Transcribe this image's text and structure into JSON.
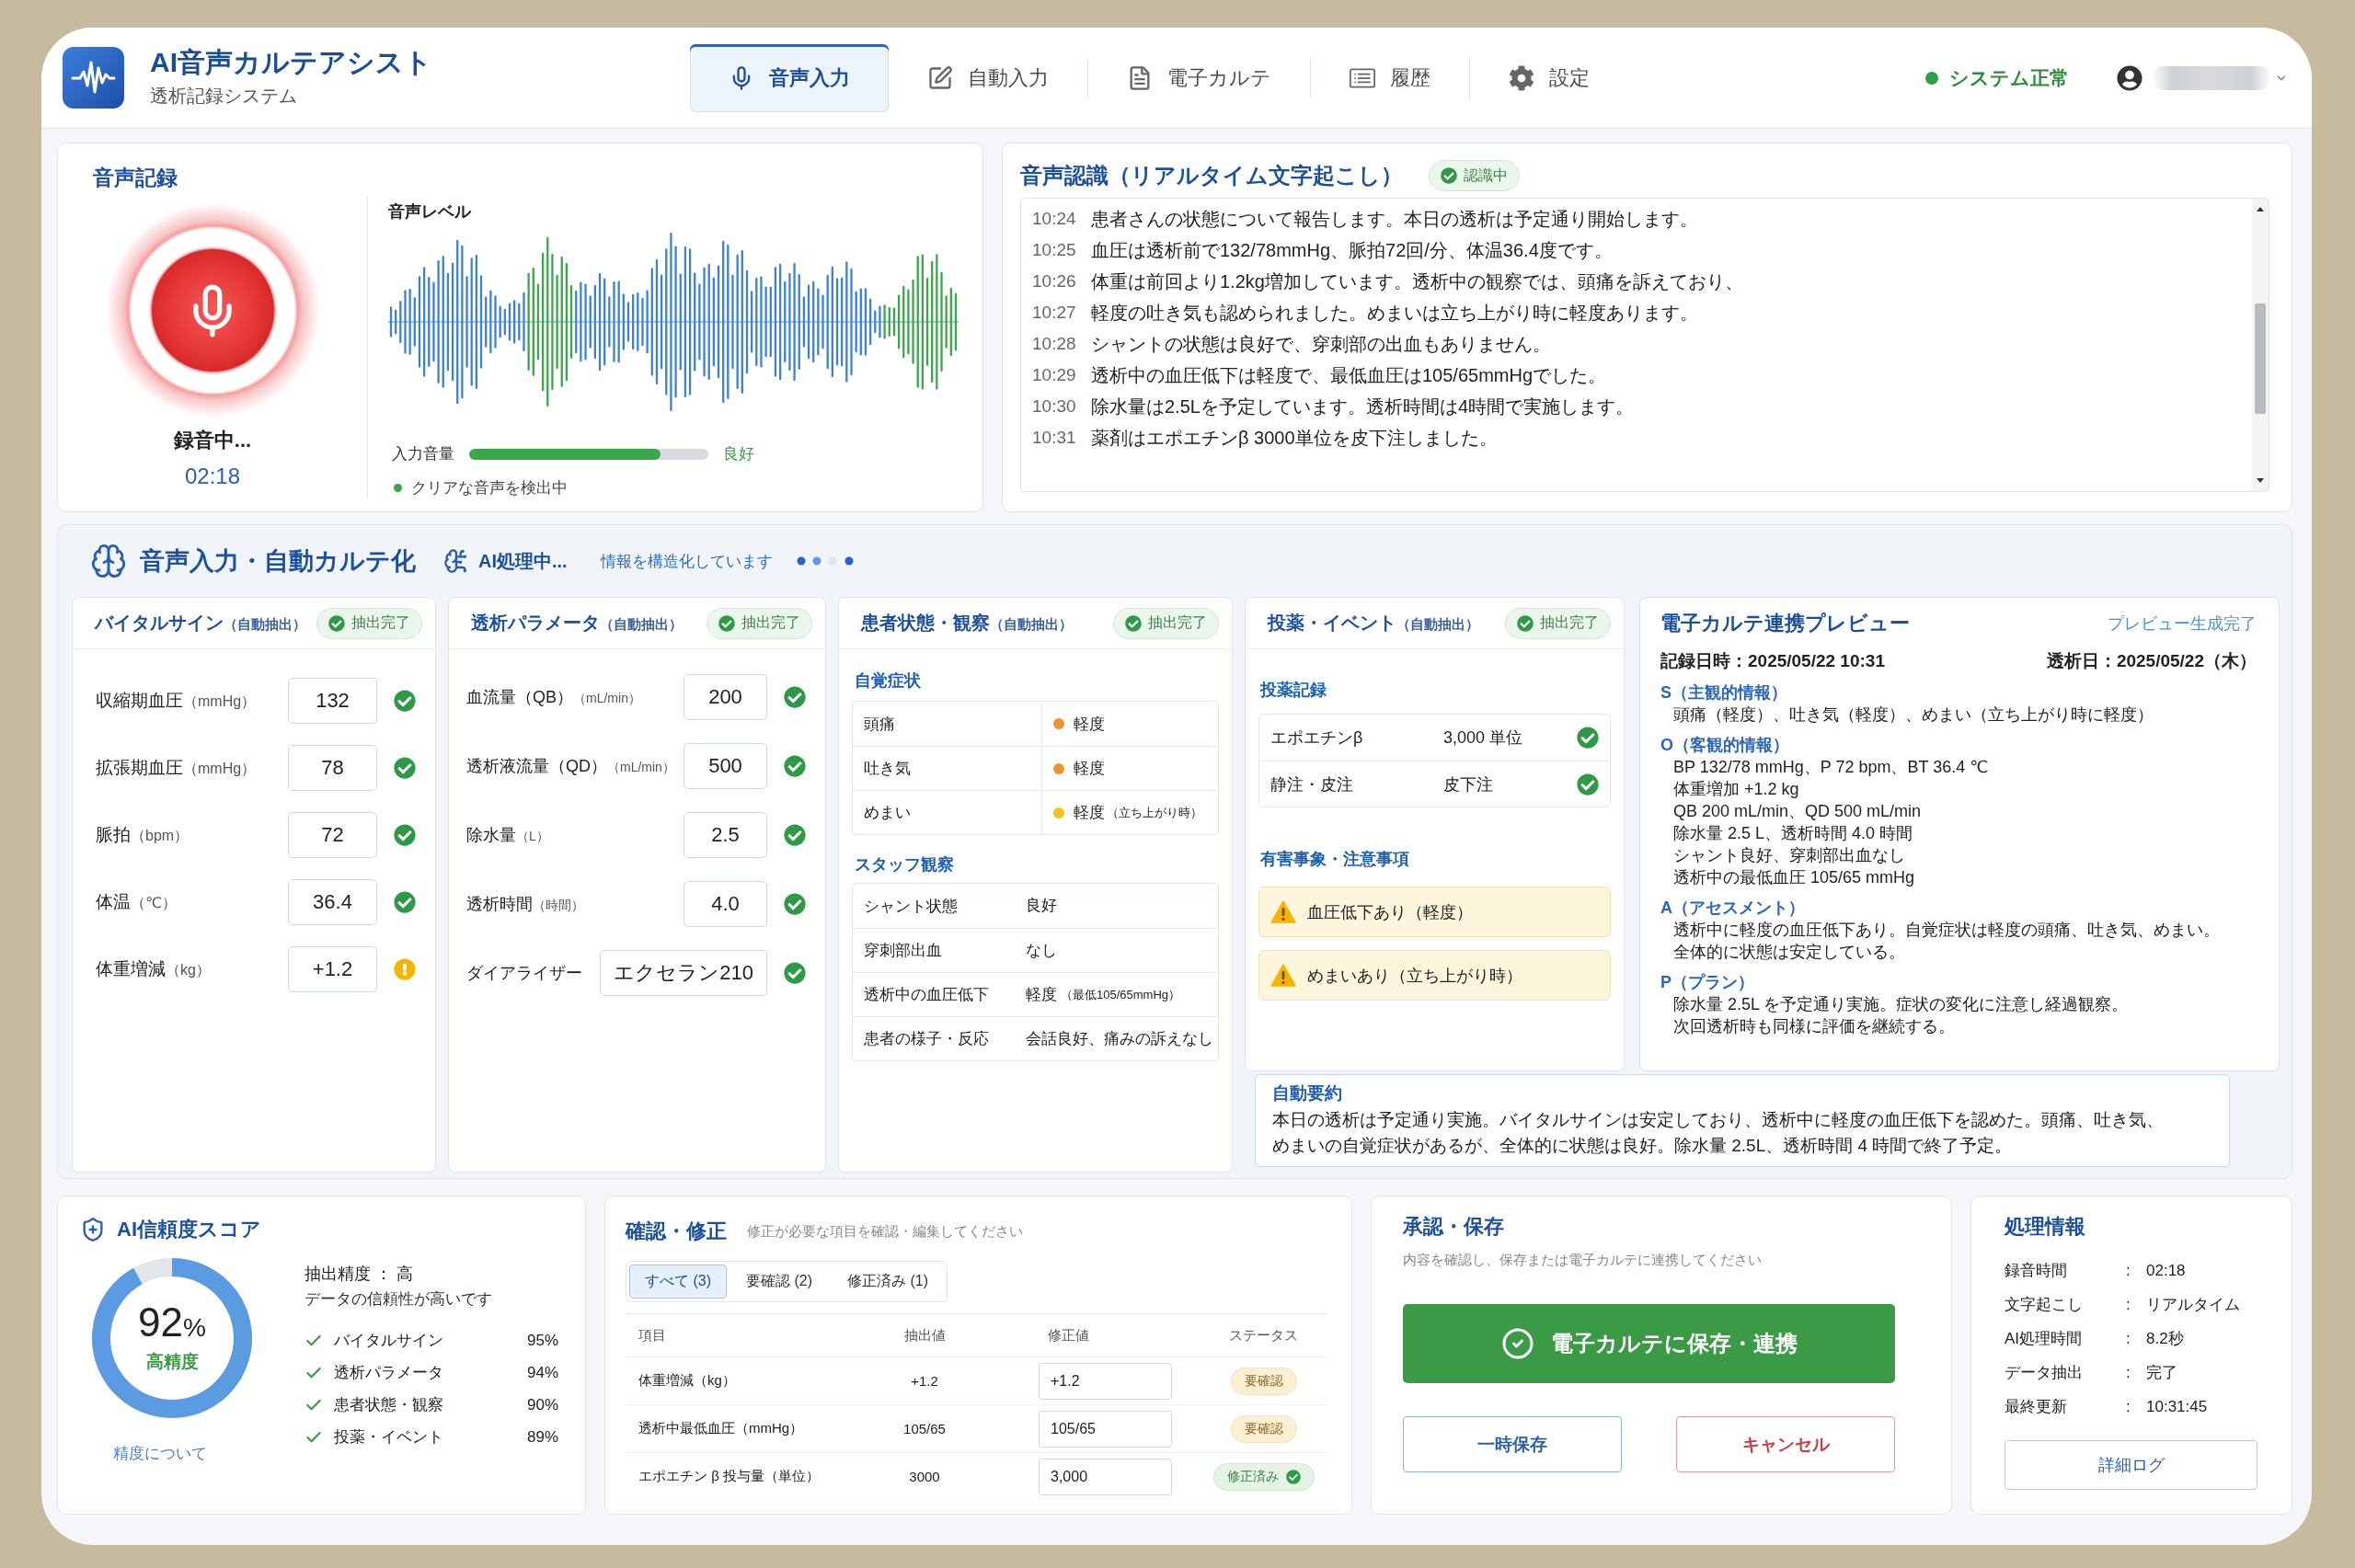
{
  "header": {
    "title": "AI音声カルテアシスト",
    "subtitle": "透析記録システム",
    "nav": [
      {
        "label": "音声入力",
        "kind": "mic",
        "selected": true
      },
      {
        "label": "自動入力",
        "kind": "edit",
        "selected": false
      },
      {
        "label": "電子カルテ",
        "kind": "document",
        "selected": false
      },
      {
        "label": "履歴",
        "kind": "list",
        "selected": false
      },
      {
        "label": "設定",
        "kind": "gear",
        "selected": false
      }
    ],
    "system_status": "システム正常"
  },
  "recording": {
    "title": "音声記録",
    "status": "録音中...",
    "time": "02:18",
    "level_title": "音声レベル",
    "input": {
      "label": "入力音量",
      "level": 0.8,
      "reading": "良好"
    },
    "detection": "クリアな音声を検出中"
  },
  "transcript": {
    "title": "音声認識（リアルタイム文字起こし）",
    "badge": "認識中",
    "lines": [
      {
        "time": "10:24",
        "text": "患者さんの状態について報告します。本日の透析は予定通り開始します。"
      },
      {
        "time": "10:25",
        "text": "血圧は透析前で132/78mmHg、脈拍72回/分、体温36.4度です。"
      },
      {
        "time": "10:26",
        "text": "体重は前回より1.2kg増加しています。透析中の観察では、頭痛を訴えており、"
      },
      {
        "time": "10:27",
        "text": "軽度の吐き気も認められました。めまいは立ち上がり時に軽度あります。"
      },
      {
        "time": "10:28",
        "text": "シャントの状態は良好で、穿刺部の出血もありません。"
      },
      {
        "time": "10:29",
        "text": "透析中の血圧低下は軽度で、最低血圧は105/65mmHgでした。"
      },
      {
        "time": "10:30",
        "text": "除水量は2.5Lを予定しています。透析時間は4時間で実施します。"
      },
      {
        "time": "10:31",
        "text": "薬剤はエポエチンβ 3000単位を皮下注しました。"
      }
    ]
  },
  "auto_chart": {
    "title": "音声入力・自動カルテ化",
    "ai_status": "AI処理中...",
    "ai_detail": "情報を構造化しています",
    "vitals": {
      "title": "バイタルサイン",
      "title_note": "（自動抽出）",
      "badge": "抽出完了",
      "rows": [
        {
          "label": "収縮期血圧",
          "unit": "（mmHg）",
          "value": "132",
          "flagged": false
        },
        {
          "label": "拡張期血圧",
          "unit": "（mmHg）",
          "value": "78",
          "flagged": false
        },
        {
          "label": "脈拍",
          "unit": "（bpm）",
          "value": "72",
          "flagged": false
        },
        {
          "label": "体温",
          "unit": "（℃）",
          "value": "36.4",
          "flagged": false
        },
        {
          "label": "体重増減",
          "unit": "（kg）",
          "value": "+1.2",
          "flagged": true
        }
      ]
    },
    "params": {
      "title": "透析パラメータ",
      "title_note": "（自動抽出）",
      "badge": "抽出完了",
      "rows": [
        {
          "label": "血流量（QB）",
          "unit": "（mL/min）",
          "value": "200",
          "flagged": false
        },
        {
          "label": "透析液流量（QD）",
          "unit": "（mL/min）",
          "value": "500",
          "flagged": false
        },
        {
          "label": "除水量",
          "unit": "（L）",
          "value": "2.5",
          "flagged": false
        },
        {
          "label": "透析時間",
          "unit": "（時間）",
          "value": "4.0",
          "flagged": false
        },
        {
          "label": "ダイアライザー",
          "value": "エクセラン210",
          "flagged": false
        }
      ]
    },
    "patient": {
      "title": "患者状態・観察",
      "title_note": "（自動抽出）",
      "badge": "抽出完了",
      "symptoms": {
        "title": "自覚症状",
        "rows": [
          {
            "label": "頭痛",
            "value": "軽度",
            "color": "#f0922e"
          },
          {
            "label": "吐き気",
            "value": "軽度",
            "color": "#f0922e"
          },
          {
            "label": "めまい",
            "value": "軽度",
            "note": "（立ち上がり時）",
            "color": "#f5c21b"
          }
        ]
      },
      "staff": {
        "title": "スタッフ観察",
        "rows": [
          {
            "label": "シャント状態",
            "value": "良好"
          },
          {
            "label": "穿刺部出血",
            "value": "なし"
          },
          {
            "label": "透析中の血圧低下",
            "value": "軽度",
            "note": "（最低105/65mmHg）"
          },
          {
            "label": "患者の様子・反応",
            "value": "会話良好、痛みの訴えなし"
          }
        ]
      }
    },
    "meds": {
      "title": "投薬・イベント",
      "title_note": "（自動抽出）",
      "badge": "抽出完了",
      "records_title": "投薬記録",
      "records": [
        {
          "label": "エポエチンβ",
          "value": "3,000 単位",
          "confirmed": true
        },
        {
          "label": "静注・皮注",
          "value": "皮下注",
          "confirmed": true
        }
      ],
      "alerts_title": "有害事象・注意事項",
      "alerts": [
        "血圧低下あり（軽度）",
        "めまいあり（立ち上がり時）"
      ]
    },
    "preview": {
      "title": "電子カルテ連携プレビュー",
      "status": "プレビュー生成完了",
      "record_date": "記録日時：2025/05/22 10:31",
      "dialysis_date": "透析日：2025/05/22（木）",
      "sections": [
        {
          "heading": "S（主観的情報）",
          "lines": [
            "頭痛（軽度）、吐き気（軽度）、めまい（立ち上がり時に軽度）"
          ]
        },
        {
          "heading": "O（客観的情報）",
          "lines": [
            "BP 132/78 mmHg、P 72 bpm、BT 36.4 ℃",
            "体重増加 +1.2 kg",
            "QB 200 mL/min、QD 500 mL/min",
            "除水量 2.5 L、透析時間 4.0 時間",
            "シャント良好、穿刺部出血なし",
            "透析中の最低血圧 105/65 mmHg"
          ]
        },
        {
          "heading": "A（アセスメント）",
          "lines": [
            "透析中に軽度の血圧低下あり。自覚症状は軽度の頭痛、吐き気、めまい。",
            "全体的に状態は安定している。"
          ]
        },
        {
          "heading": "P（プラン）",
          "lines": [
            "除水量 2.5L を予定通り実施。症状の変化に注意し経過観察。",
            "次回透析時も同様に評価を継続する。"
          ]
        }
      ]
    },
    "summary": {
      "title": "自動要約",
      "text": "本日の透析は予定通り実施。バイタルサインは安定しており、透析中に軽度の血圧低下を認めた。頭痛、吐き気、めまいの自覚症状があるが、全体的に状態は良好。除水量 2.5L、透析時間 4 時間で終了予定。"
    }
  },
  "confidence": {
    "title": "AI信頼度スコア",
    "score": "92",
    "unit": "%",
    "grade": "高精度",
    "accuracy": "抽出精度 ： 高",
    "note": "データの信頼性が高いです",
    "items": [
      {
        "label": "バイタルサイン",
        "value": "95%"
      },
      {
        "label": "透析パラメータ",
        "value": "94%"
      },
      {
        "label": "患者状態・観察",
        "value": "90%"
      },
      {
        "label": "投薬・イベント",
        "value": "89%"
      }
    ],
    "link": "精度について"
  },
  "review": {
    "title": "確認・修正",
    "hint": "修正が必要な項目を確認・編集してください",
    "tabs": [
      {
        "label": "すべて (3)",
        "selected": true
      },
      {
        "label": "要確認 (2)",
        "selected": false
      },
      {
        "label": "修正済み (1)",
        "selected": false
      }
    ],
    "columns": [
      "項目",
      "抽出値",
      "修正値",
      "ステータス"
    ],
    "rows": [
      {
        "item": "体重増減（kg）",
        "extracted": "+1.2",
        "corrected": "+1.2",
        "status": "要確認",
        "kind": "pending"
      },
      {
        "item": "透析中最低血圧（mmHg）",
        "extracted": "105/65",
        "corrected": "105/65",
        "status": "要確認",
        "kind": "pending"
      },
      {
        "item": "エポエチン β 投与量（単位）",
        "extracted": "3000",
        "corrected": "3,000",
        "status": "修正済み",
        "kind": "done"
      }
    ]
  },
  "approval": {
    "title": "承認・保存",
    "hint": "内容を確認し、保存または電子カルテに連携してください",
    "primary": "電子カルテに保存・連携",
    "save": "一時保存",
    "cancel": "キャンセル"
  },
  "processing": {
    "title": "処理情報",
    "rows": [
      {
        "label": "録音時間",
        "separator": ":",
        "value": "02:18"
      },
      {
        "label": "文字起こし",
        "separator": ":",
        "value": "リアルタイム"
      },
      {
        "label": "AI処理時間",
        "separator": ":",
        "value": "8.2秒"
      },
      {
        "label": "データ抽出",
        "separator": ":",
        "value": "完了"
      },
      {
        "label": "最終更新",
        "separator": ":",
        "value": "10:31:45"
      }
    ],
    "button": "詳細ログ"
  }
}
